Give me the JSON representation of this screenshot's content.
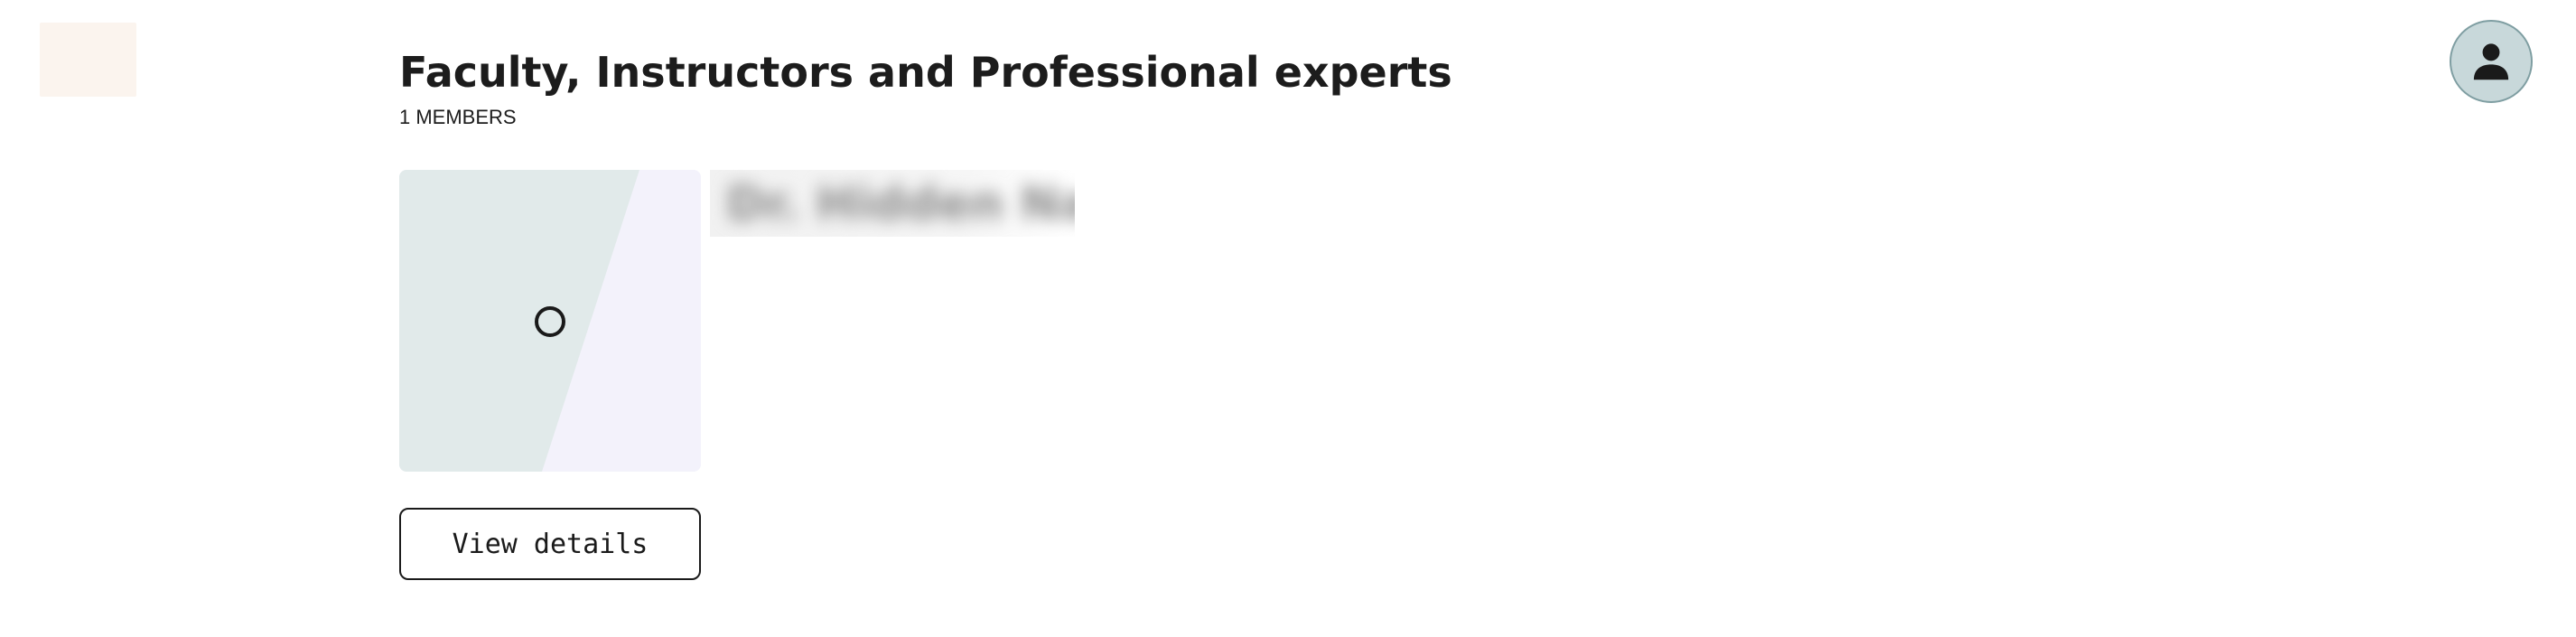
{
  "header": {
    "title": "Faculty, Instructors and Professional experts",
    "member_count": "1 MEMBERS"
  },
  "member_card": {
    "name": "Dr. Hidden Name",
    "button_label": "View details",
    "thumb_colors": {
      "left": "#e1eaea",
      "right": "#f3f2fb"
    }
  },
  "icons": {
    "logo": "brand-logo-placeholder",
    "avatar": "user-icon",
    "thumb": "circle-icon"
  },
  "colors": {
    "avatar_bg": "#c8d8da",
    "avatar_border": "#7f9ea2",
    "logo_bg": "#fbf4ee"
  }
}
